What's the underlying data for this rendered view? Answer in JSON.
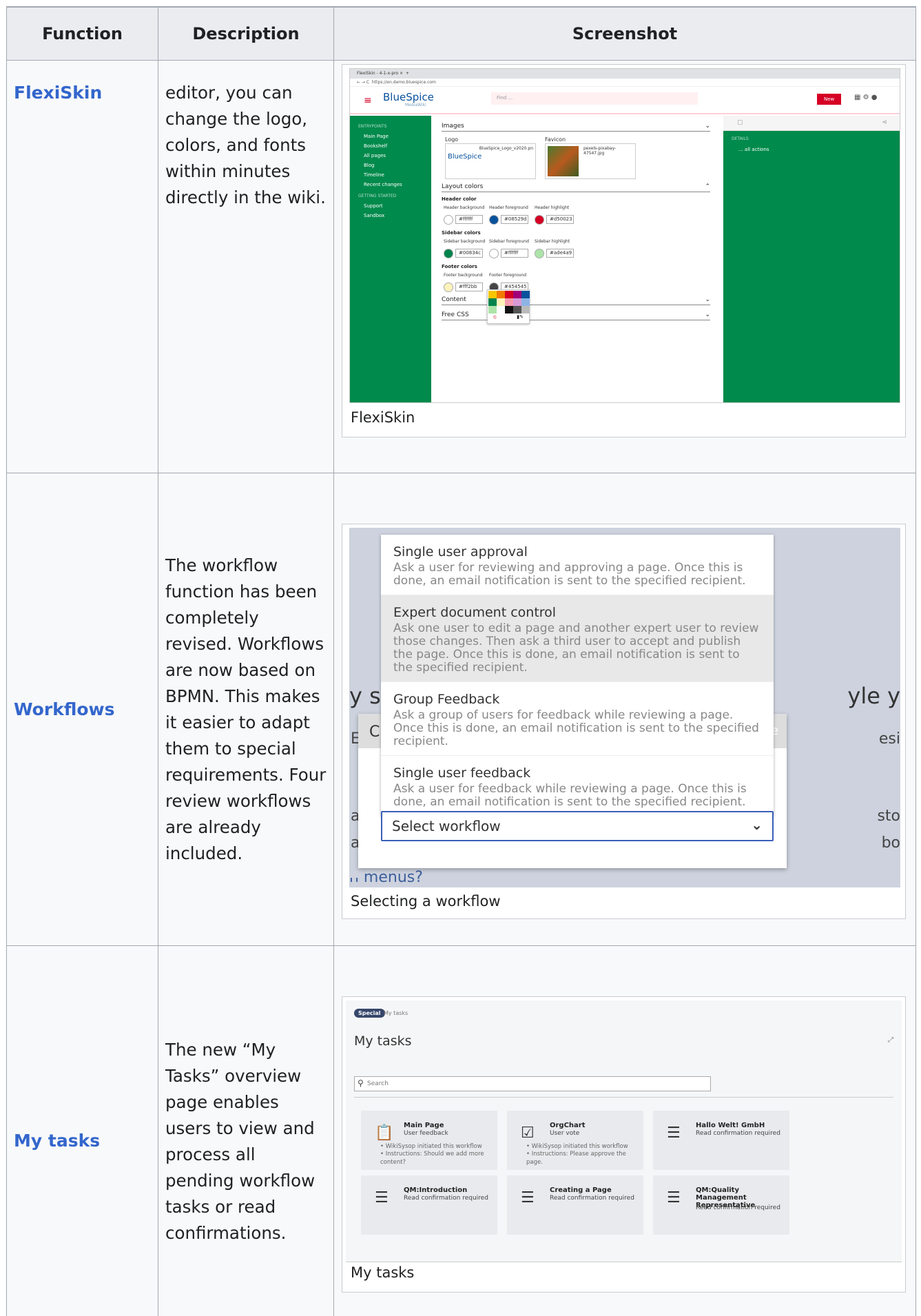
{
  "headers": {
    "function": "Function",
    "description": "Description",
    "screenshot": "Screenshot"
  },
  "rows": [
    {
      "function": "FlexiSkin",
      "description": "editor, you can change the logo, colors, and fonts within minutes directly in the wiki.",
      "caption": "FlexiSkin"
    },
    {
      "function": "Workflows",
      "description": "The workflow function has been completely revised. Workflows are now based on BPMN. This makes it easier to adapt them to special requirements. Four review workflows are already included.",
      "caption": "Selecting a workflow"
    },
    {
      "function": "My tasks",
      "description": "The new “My Tasks” overview page enables users to view and process all pending workflow tasks or read confirmations.",
      "caption": "My tasks"
    }
  ],
  "flexiskin": {
    "tab_title": "FlexiSkin - 4-1-x-pro",
    "url": "https://en.demo.bluespice.com",
    "logo_name": "BlueSpice",
    "logo_sub": "MediaWiki",
    "find_placeholder": "Find ...",
    "new_button": "New",
    "sidebar_heading": "ENTRYPOINTS",
    "sidebar_items": [
      "Main Page",
      "Bookshelf",
      "All pages",
      "Blog",
      "Timeline",
      "Recent changes"
    ],
    "sidebar_heading2": "GETTING STARTED",
    "sidebar_items2": [
      "Support",
      "Sandbox"
    ],
    "right_heading": "DETAILS",
    "right_item": "... all actions",
    "images_label": "Images",
    "logo_label": "Logo",
    "favicon_label": "Favicon",
    "logo_file": "BlueSpice_Logo_v2020.pn",
    "favicon_file": "pexels-pixabay-47547.jpg",
    "layout_colors_label": "Layout colors",
    "header_color_label": "Header color",
    "header_fields": [
      {
        "label": "Header background",
        "hex": "#ffffff",
        "color": "#ffffff"
      },
      {
        "label": "Header foreground",
        "hex": "#08529d",
        "color": "#08529d"
      },
      {
        "label": "Header highlight",
        "hex": "#d50023",
        "color": "#d50023"
      }
    ],
    "sidebar_colors_label": "Sidebar colors",
    "sidebar_fields": [
      {
        "label": "Sidebar background",
        "hex": "#00834c",
        "color": "#00834c"
      },
      {
        "label": "Sidebar foreground",
        "hex": "#ffffff",
        "color": "#ffffff"
      },
      {
        "label": "Sidebar highlight",
        "hex": "#ade4a9",
        "color": "#ade4a9"
      }
    ],
    "footer_colors_label": "Footer colors",
    "footer_fields": [
      {
        "label": "Footer background",
        "hex": "#fff2bb",
        "color": "#fff2bb"
      },
      {
        "label": "Footer foreground",
        "hex": "#454545",
        "color": "#454545"
      }
    ],
    "content_label": "Content",
    "free_css_label": "Free CSS"
  },
  "workflows": {
    "options": [
      {
        "title": "Single user approval",
        "desc": "Ask a user for reviewing and approving a page. Once this is done, an email notification is sent to the specified recipient."
      },
      {
        "title": "Expert document control",
        "desc": "Ask one user to edit a page and another expert user to review those changes. Then ask a third user to accept and publish the page. Once this is done, an email notification is sent to the specified recipient."
      },
      {
        "title": "Group Feedback",
        "desc": "Ask a group of users for feedback while reviewing a page. Once this is done, an email notification is sent to the specified recipient."
      },
      {
        "title": "Single user feedback",
        "desc": "Ask a user for feedback while reviewing a page. Once this is done, an email notification is sent to the specified recipient."
      }
    ],
    "select_label": "Select workflow",
    "bg_left": "y st",
    "bg_right": "yle y",
    "bg_bottom": "h menus?",
    "bg_row2_left": "E",
    "bg_row2_c": "C",
    "bg_row2_right": "esi",
    "bg_row3_left": "a",
    "bg_row3_right": "sto",
    "bg_row4_left": "at",
    "bg_row4_right": "bo",
    "bg_e": "e"
  },
  "mytasks": {
    "badge": "Special",
    "crumb": "My tasks",
    "title": "My tasks",
    "search_placeholder": "Search",
    "tasks": [
      {
        "title": "Main Page",
        "subtitle": "User feedback",
        "bullets": [
          "WikiSysop initiated this workflow",
          "Instructions: Should we add more content?"
        ]
      },
      {
        "title": "OrgChart",
        "subtitle": "User vote",
        "bullets": [
          "WikiSysop initiated this workflow",
          "Instructions: Please approve the page."
        ]
      },
      {
        "title": "Hallo Welt! GmbH",
        "subtitle": "Read confirmation required",
        "bullets": []
      },
      {
        "title": "QM:Introduction",
        "subtitle": "Read confirmation required",
        "bullets": []
      },
      {
        "title": "Creating a Page",
        "subtitle": "Read confirmation required",
        "bullets": []
      },
      {
        "title": "QM:Quality Management Representative",
        "subtitle": "Read confirmation required",
        "bullets": []
      }
    ]
  }
}
